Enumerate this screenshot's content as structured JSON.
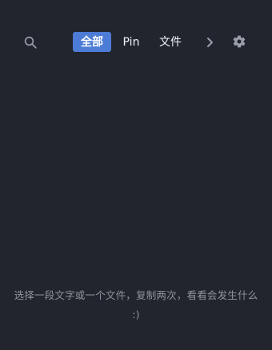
{
  "header": {
    "search_icon": "search-icon",
    "next_icon": "chevron-right-icon",
    "settings_icon": "gear-icon",
    "tabs": [
      {
        "label": "全部",
        "active": true
      },
      {
        "label": "Pin",
        "active": false
      },
      {
        "label": "文件",
        "active": false
      }
    ]
  },
  "empty_state": {
    "line1": "选择一段文字或一个文件，复制两次，看看会发生什么",
    "line2": ":)"
  },
  "colors": {
    "background": "#22252d",
    "accent": "#4d7cd6",
    "muted_text": "#8f949d",
    "icon": "#9aa0ab"
  }
}
